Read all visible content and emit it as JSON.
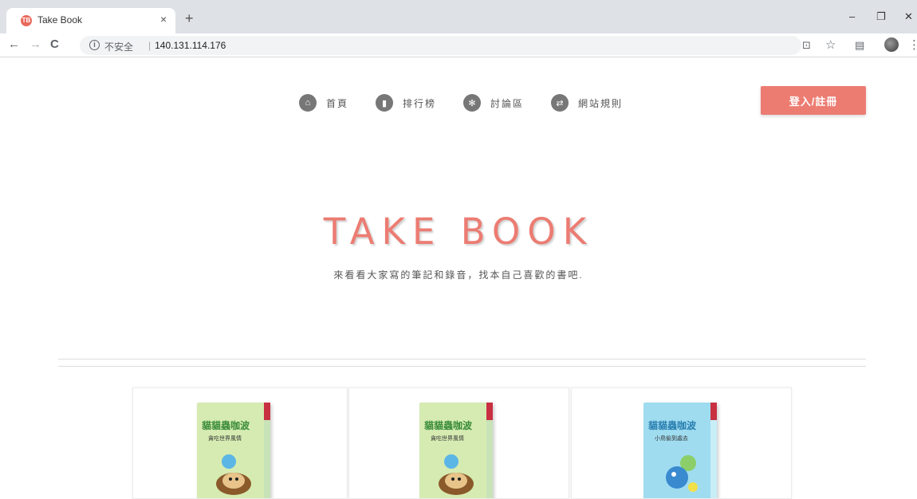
{
  "browser": {
    "tab_title": "Take Book",
    "tab_favicon": "TB",
    "close_glyph": "×",
    "newtab_glyph": "+",
    "window_controls": [
      "–",
      "❐",
      "✕"
    ],
    "nav": {
      "back": "←",
      "forward": "→",
      "reload": "C"
    },
    "info_glyph": "i",
    "security_label": "不安全",
    "url": "140.131.114.176",
    "toolbar_icons": {
      "translate": "⊡",
      "bookmark": "☆",
      "reader": "▤",
      "menu": "⋮"
    }
  },
  "nav": {
    "items": [
      {
        "label": "首頁",
        "icon": "home-icon",
        "glyph": "⌂"
      },
      {
        "label": "排行榜",
        "icon": "bar-chart-icon",
        "glyph": "▮"
      },
      {
        "label": "討論區",
        "icon": "gear-icon",
        "glyph": "✻"
      },
      {
        "label": "網站規則",
        "icon": "retweet-icon",
        "glyph": "⇄"
      }
    ],
    "login_label": "登入/註冊"
  },
  "hero": {
    "title": "TAKE BOOK",
    "subtitle": "來看看大家寫的筆記和錄音，找本自己喜歡的書吧."
  },
  "books": [
    {
      "cover_title": "貓貓蟲咖波",
      "cover_subtitle": "貪吃世界風情",
      "color": "#d6ebb2"
    },
    {
      "cover_title": "貓貓蟲咖波",
      "cover_subtitle": "貪吃世界風情",
      "color": "#d6ebb2"
    },
    {
      "cover_title": "貓貓蟲咖波",
      "cover_subtitle": "小鳥偷到處去",
      "color": "#9fdcf0"
    }
  ],
  "colors": {
    "accent": "#ec7c72",
    "nav_icon": "#777777"
  }
}
